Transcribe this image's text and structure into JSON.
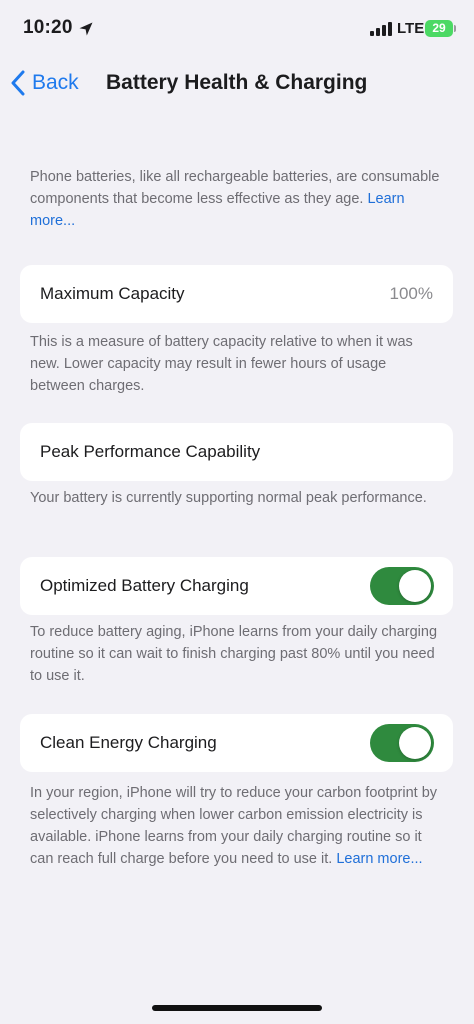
{
  "status_bar": {
    "time": "10:20",
    "network": "LTE",
    "battery_level": "29"
  },
  "nav": {
    "back_label": "Back",
    "title": "Battery Health & Charging"
  },
  "intro": {
    "text": "Phone batteries, like all rechargeable batteries, are consumable components that become less effective as they age. ",
    "link": "Learn more..."
  },
  "max_capacity": {
    "label": "Maximum Capacity",
    "value": "100%",
    "description": "This is a measure of battery capacity relative to when it was new. Lower capacity may result in fewer hours of usage between charges."
  },
  "peak_performance": {
    "label": "Peak Performance Capability",
    "description": "Your battery is currently supporting normal peak performance."
  },
  "optimized_charging": {
    "label": "Optimized Battery Charging",
    "enabled": true,
    "description": "To reduce battery aging, iPhone learns from your daily charging routine so it can wait to finish charging past 80% until you need to use it."
  },
  "clean_energy": {
    "label": "Clean Energy Charging",
    "enabled": true,
    "description": "In your region, iPhone will try to reduce your carbon footprint by selectively charging when lower carbon emission electricity is available. iPhone learns from your daily charging routine so it can reach full charge before you need to use it. ",
    "link": "Learn more..."
  },
  "colors": {
    "accent": "#1f7aed",
    "toggle_on": "#2f8a3e",
    "background": "#f2f1f6",
    "battery": "#4cd964"
  }
}
